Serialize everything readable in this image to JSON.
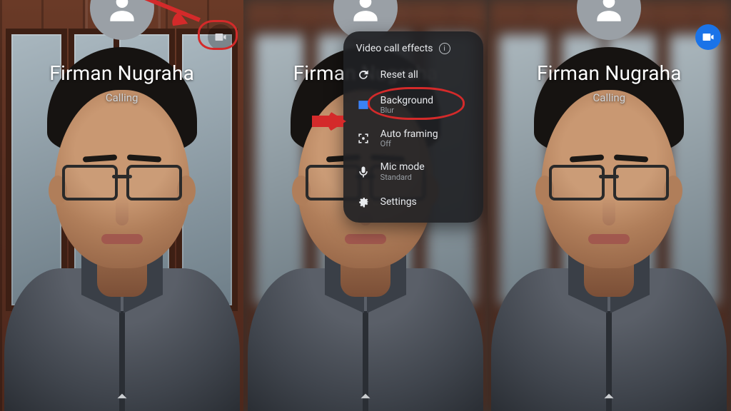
{
  "caller": {
    "name": "Firman Nugraha",
    "status": "Calling"
  },
  "panels": [
    {
      "blurred": false,
      "effects_button_active": false,
      "show_menu": false,
      "annotation": {
        "circle": true,
        "arrow": true
      }
    },
    {
      "blurred": true,
      "effects_button_active": false,
      "show_menu": true,
      "annotation": {
        "circle_menu_item": "background",
        "arrow": true
      }
    },
    {
      "blurred": true,
      "effects_button_active": true,
      "show_menu": false,
      "annotation": {}
    }
  ],
  "effects_menu": {
    "title": "Video call effects",
    "reset_label": "Reset all",
    "items": [
      {
        "id": "background",
        "label": "Background",
        "sub": "Blur",
        "icon": "image",
        "accent": true
      },
      {
        "id": "autoframing",
        "label": "Auto framing",
        "sub": "Off",
        "icon": "frame",
        "accent": false
      },
      {
        "id": "micmode",
        "label": "Mic mode",
        "sub": "Standard",
        "icon": "mic",
        "accent": false
      },
      {
        "id": "settings",
        "label": "Settings",
        "sub": "",
        "icon": "gear",
        "accent": false
      }
    ]
  },
  "colors": {
    "accent": "#1a73e8",
    "annotation": "#d42a2a"
  }
}
